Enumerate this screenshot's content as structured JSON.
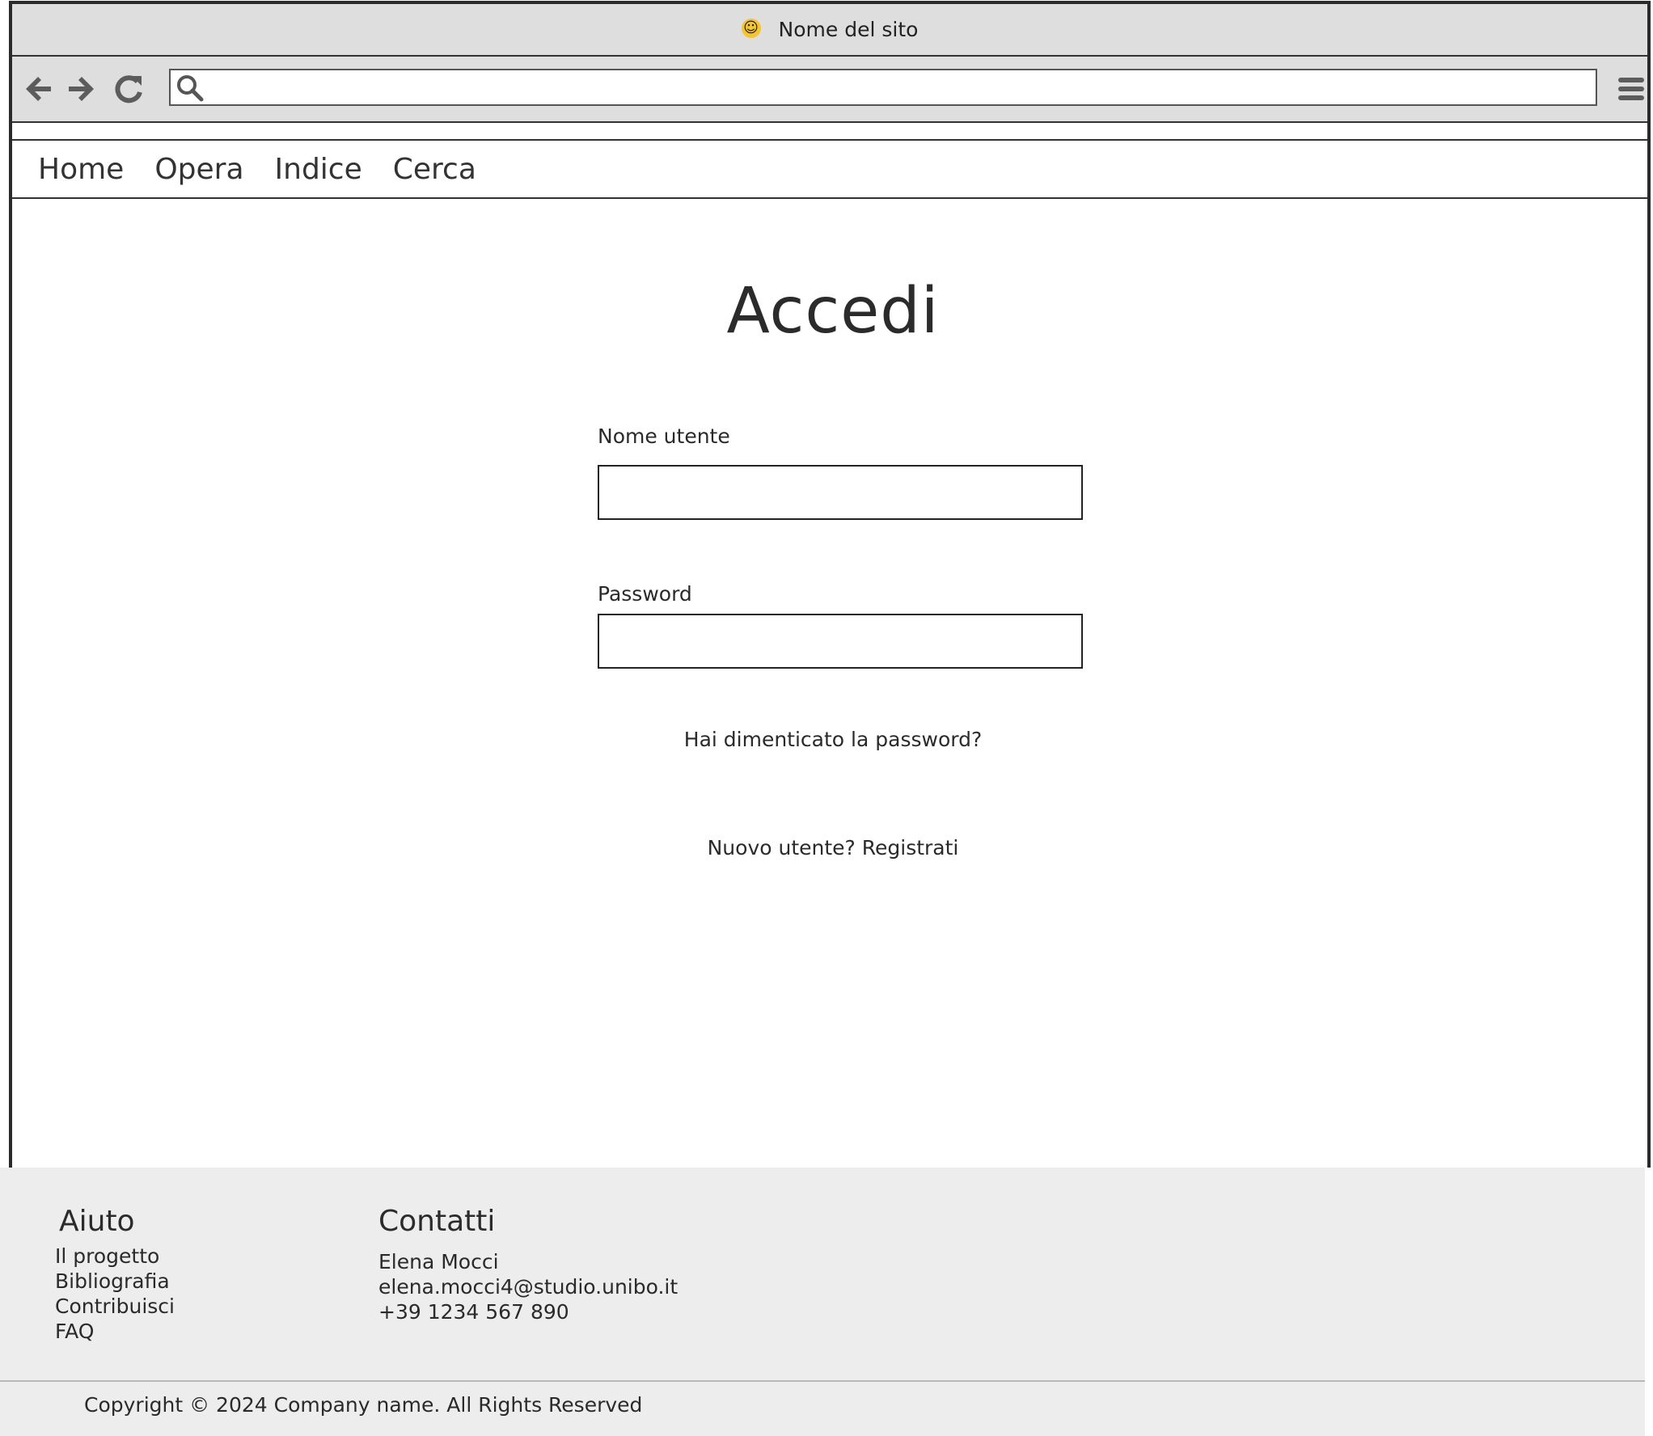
{
  "browser": {
    "title": "Nome del sito",
    "title_icon": "smiley-icon",
    "url": "",
    "nav_icons": [
      "back-arrow-icon",
      "forward-arrow-icon",
      "reload-icon",
      "search-icon",
      "menu-icon"
    ]
  },
  "site_nav": {
    "items": [
      "Home",
      "Opera",
      "Indice",
      "Cerca"
    ]
  },
  "login": {
    "title": "Accedi",
    "username_label": "Nome utente",
    "username_value": "",
    "password_label": "Password",
    "password_value": "",
    "forgot_link": "Hai dimenticato la password?",
    "register_link": "Nuovo utente? Registrati"
  },
  "footer": {
    "help_heading": "Aiuto",
    "help_links": [
      "Il progetto",
      "Bibliografia",
      "Contribuisci",
      "FAQ"
    ],
    "contacts_heading": "Contatti",
    "contacts": [
      "Elena Mocci",
      "elena.mocci4@studio.unibo.it",
      "+39 1234 567 890"
    ],
    "copyright": "Copyright © 2024 Company name. All Rights Reserved"
  }
}
